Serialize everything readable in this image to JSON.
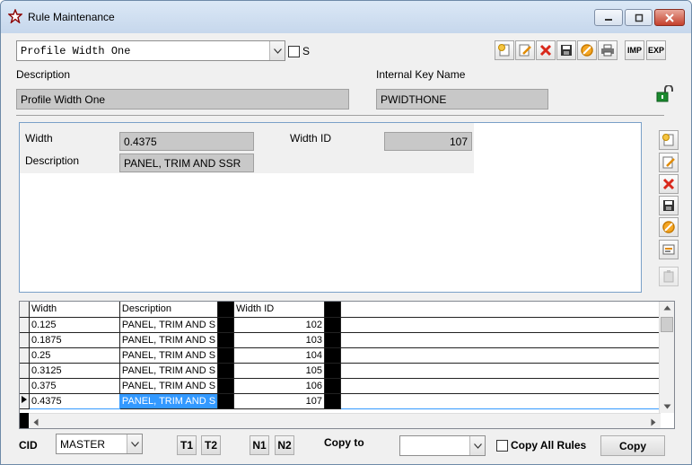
{
  "window": {
    "title": "Rule Maintenance"
  },
  "rule_combo": {
    "value": "Profile Width One",
    "s_label": "S"
  },
  "toolbar": {
    "imp_label": "IMP",
    "exp_label": "EXP"
  },
  "description": {
    "label": "Description",
    "value": "Profile Width One"
  },
  "internal_key": {
    "label": "Internal Key Name",
    "value": "PWIDTHONE"
  },
  "detail": {
    "width_label": "Width",
    "width_value": "0.4375",
    "width_id_label": "Width ID",
    "width_id_value": "107",
    "description_label": "Description",
    "description_value": "PANEL, TRIM AND SSR"
  },
  "grid": {
    "columns": [
      "Width",
      "Description",
      "Width ID"
    ],
    "rows": [
      {
        "width": "0.125",
        "description": "PANEL, TRIM AND S",
        "width_id": "102"
      },
      {
        "width": "0.1875",
        "description": "PANEL, TRIM AND S",
        "width_id": "103"
      },
      {
        "width": "0.25",
        "description": "PANEL, TRIM AND S",
        "width_id": "104"
      },
      {
        "width": "0.3125",
        "description": "PANEL, TRIM AND S",
        "width_id": "105"
      },
      {
        "width": "0.375",
        "description": "PANEL, TRIM AND S",
        "width_id": "106"
      },
      {
        "width": "0.4375",
        "description": "PANEL, TRIM AND S",
        "width_id": "107"
      }
    ]
  },
  "footer": {
    "cid_label": "CID",
    "cid_value": "MASTER",
    "t1": "T1",
    "t2": "T2",
    "n1": "N1",
    "n2": "N2",
    "copy_to_label": "Copy to",
    "copy_to_value": "",
    "copy_all_label": "Copy All Rules",
    "copy_button": "Copy"
  },
  "colors": {
    "selection": "#3399ff",
    "panel_border": "#7aa0c8"
  }
}
